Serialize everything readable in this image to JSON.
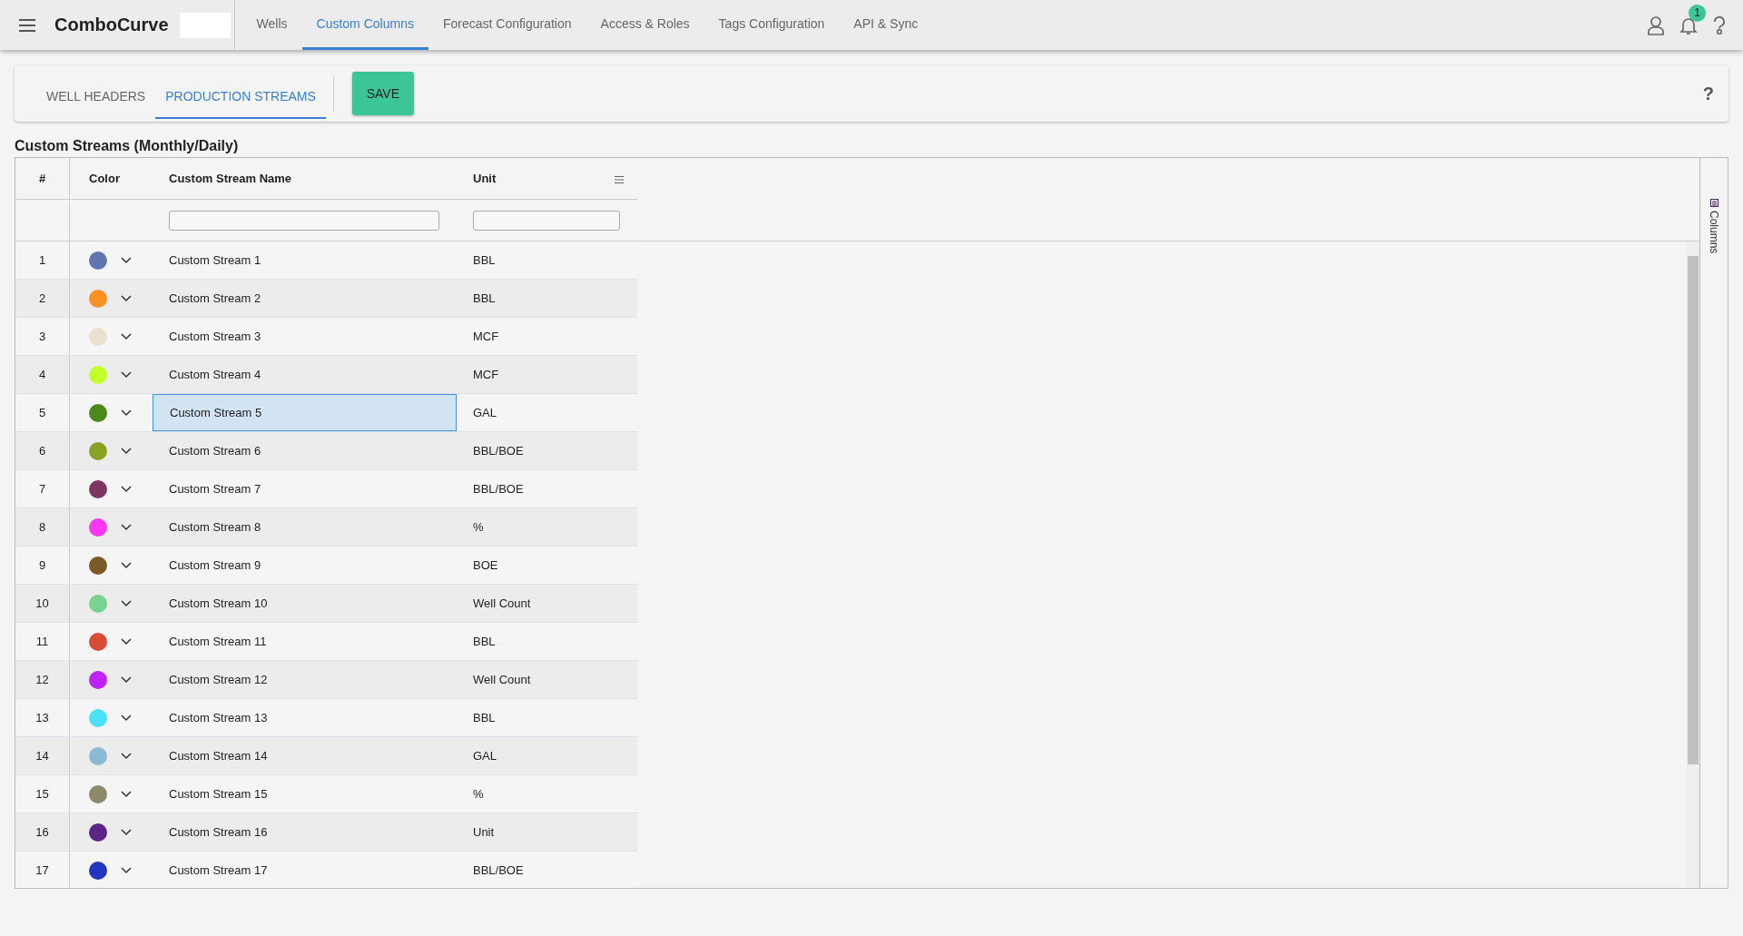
{
  "app": {
    "logo": "ComboCurve",
    "nav": [
      {
        "label": "Wells",
        "selected": false
      },
      {
        "label": "Custom Columns",
        "selected": true
      },
      {
        "label": "Forecast Configuration",
        "selected": false
      },
      {
        "label": "Access & Roles",
        "selected": false
      },
      {
        "label": "Tags Configuration",
        "selected": false
      },
      {
        "label": "API & Sync",
        "selected": false
      }
    ],
    "notification_count": "1"
  },
  "subtabs": [
    {
      "label": "WELL HEADERS",
      "selected": false
    },
    {
      "label": "PRODUCTION STREAMS",
      "selected": true
    }
  ],
  "save_button": "SAVE",
  "help": "?",
  "section_title": "Custom Streams (Monthly/Daily)",
  "table": {
    "columns": [
      "#",
      "Color",
      "Custom Stream Name",
      "Unit"
    ],
    "rows": [
      {
        "num": "1",
        "color": "#5f76b0",
        "name": "Custom Stream 1",
        "unit": "BBL",
        "selected": false
      },
      {
        "num": "2",
        "color": "#f79223",
        "name": "Custom Stream 2",
        "unit": "BBL",
        "selected": false
      },
      {
        "num": "3",
        "color": "#ebdfcd",
        "name": "Custom Stream 3",
        "unit": "MCF",
        "selected": false
      },
      {
        "num": "4",
        "color": "#c3ff2a",
        "name": "Custom Stream 4",
        "unit": "MCF",
        "selected": false
      },
      {
        "num": "5",
        "color": "#4b8a1a",
        "name": "Custom Stream 5",
        "unit": "GAL",
        "selected": true
      },
      {
        "num": "6",
        "color": "#88a224",
        "name": "Custom Stream 6",
        "unit": "BBL/BOE",
        "selected": false
      },
      {
        "num": "7",
        "color": "#7c3660",
        "name": "Custom Stream 7",
        "unit": "BBL/BOE",
        "selected": false
      },
      {
        "num": "8",
        "color": "#fb36f0",
        "name": "Custom Stream 8",
        "unit": "%",
        "selected": false
      },
      {
        "num": "9",
        "color": "#7a5b28",
        "name": "Custom Stream 9",
        "unit": "BOE",
        "selected": false
      },
      {
        "num": "10",
        "color": "#77d38d",
        "name": "Custom Stream 10",
        "unit": "Well Count",
        "selected": false
      },
      {
        "num": "11",
        "color": "#db4a33",
        "name": "Custom Stream 11",
        "unit": "BBL",
        "selected": false
      },
      {
        "num": "12",
        "color": "#c022f9",
        "name": "Custom Stream 12",
        "unit": "Well Count",
        "selected": false
      },
      {
        "num": "13",
        "color": "#4ce1f8",
        "name": "Custom Stream 13",
        "unit": "BBL",
        "selected": false
      },
      {
        "num": "14",
        "color": "#8bb9d6",
        "name": "Custom Stream 14",
        "unit": "GAL",
        "selected": false
      },
      {
        "num": "15",
        "color": "#8b8b6b",
        "name": "Custom Stream 15",
        "unit": "%",
        "selected": false
      },
      {
        "num": "16",
        "color": "#5b2487",
        "name": "Custom Stream 16",
        "unit": "Unit",
        "selected": false
      },
      {
        "num": "17",
        "color": "#2236c1",
        "name": "Custom Stream 17",
        "unit": "BBL/BOE",
        "selected": false
      }
    ]
  },
  "side_panel": "Columns"
}
